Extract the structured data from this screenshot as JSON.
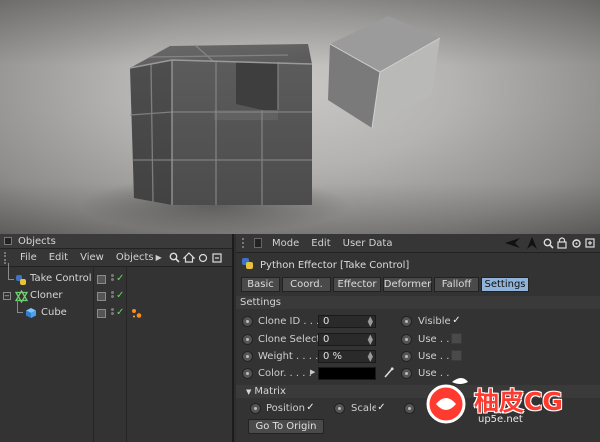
{
  "objects_panel": {
    "title": "Objects",
    "menu": [
      "File",
      "Edit",
      "View",
      "Objects"
    ],
    "items": [
      {
        "name": "Take Control",
        "icon": "python-effector-icon"
      },
      {
        "name": "Cloner",
        "icon": "cloner-icon"
      },
      {
        "name": "Cube",
        "icon": "cube-icon"
      }
    ]
  },
  "attributes_panel": {
    "menu": [
      "Mode",
      "Edit",
      "User Data"
    ],
    "object_title": "Python Effector [Take Control]",
    "tabs": [
      "Basic",
      "Coord.",
      "Effector",
      "Deformer",
      "Falloff",
      "Settings"
    ],
    "active_tab": "Settings",
    "settings_header": "Settings",
    "params": {
      "clone_id": {
        "label": "Clone ID . . . .",
        "value": "0"
      },
      "clone_select": {
        "label": "Clone Select",
        "value": "0"
      },
      "weight": {
        "label": "Weight . . . . .",
        "value": "0 %"
      },
      "color": {
        "label": "Color. . . . .",
        "value": "#000000"
      },
      "visible": {
        "label": "Visible",
        "checked": true
      },
      "use1": {
        "label": "Use . .",
        "checked": false
      },
      "use2": {
        "label": "Use . .",
        "checked": false
      },
      "use3": {
        "label": "Use . .",
        "checked": false
      }
    },
    "matrix_header": "Matrix",
    "matrix": {
      "position": {
        "label": "Position",
        "checked": true
      },
      "scale": {
        "label": "Scale",
        "checked": true
      }
    },
    "go_to_origin": "Go To Origin"
  },
  "watermark": {
    "text": "柚皮CG",
    "url": "up5e.net"
  },
  "colors": {
    "active_tab": "#8fb3d9",
    "check": "#5fdc5f",
    "watermark": "#ff3b30"
  }
}
